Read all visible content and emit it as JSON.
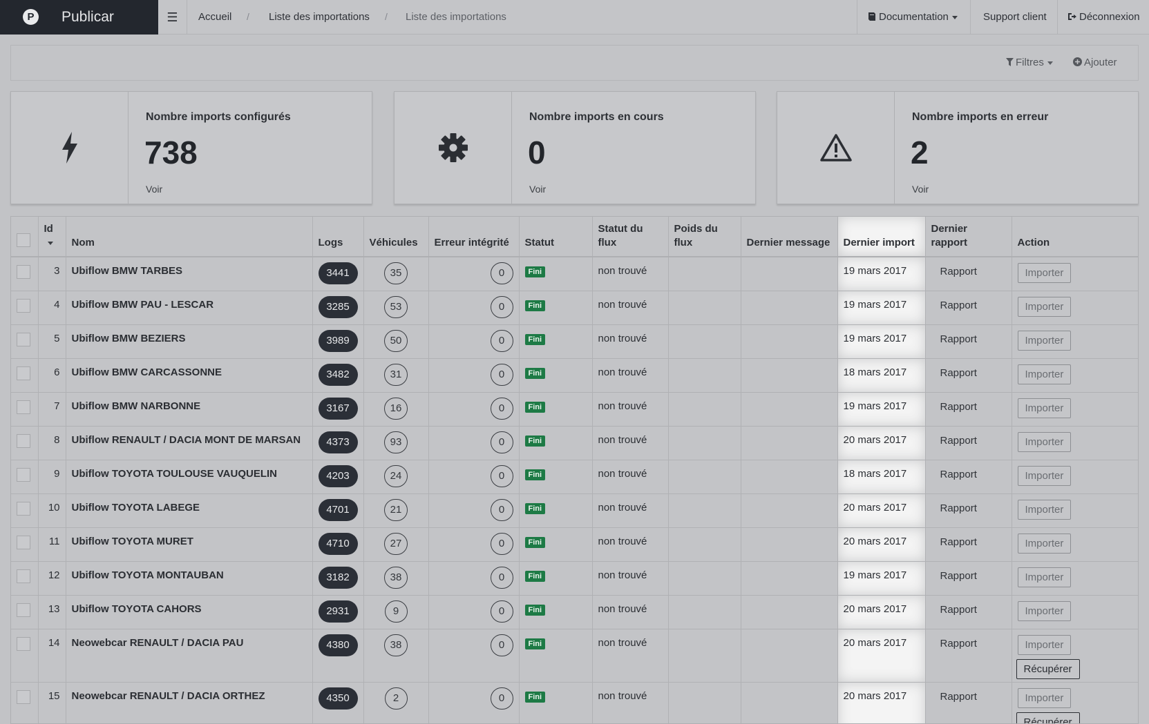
{
  "brand": {
    "name": "Publicar",
    "logo_letter": "P"
  },
  "breadcrumb": [
    "Accueil",
    "Liste des importations",
    "Liste des importations"
  ],
  "nav": {
    "documentation": "Documentation",
    "support": "Support client",
    "logout": "Déconnexion"
  },
  "toolbar": {
    "filters": "Filtres",
    "add": "Ajouter"
  },
  "cards": [
    {
      "title": "Nombre imports configurés",
      "value": "738",
      "link": "Voir",
      "icon": "bolt-icon"
    },
    {
      "title": "Nombre imports en cours",
      "value": "0",
      "link": "Voir",
      "icon": "gear-icon"
    },
    {
      "title": "Nombre imports en erreur",
      "value": "2",
      "link": "Voir",
      "icon": "warning-icon"
    }
  ],
  "table": {
    "headers": {
      "id": "Id",
      "nom": "Nom",
      "logs": "Logs",
      "vehicules": "Véhicules",
      "erreur": "Erreur intégrité",
      "statut": "Statut",
      "statut_flux": "Statut du flux",
      "poids_flux": "Poids du flux",
      "dernier_message": "Dernier message",
      "dernier_import": "Dernier import",
      "dernier_rapport": "Dernier rapport",
      "action": "Action"
    },
    "labels": {
      "fini": "Fini",
      "rapport": "Rapport",
      "importer": "Importer",
      "recuperer": "Récupérer"
    },
    "rows": [
      {
        "id": "3",
        "nom": "Ubiflow BMW TARBES",
        "logs": "3441",
        "vehicules": "35",
        "erreur": "0",
        "statut": "Fini",
        "statut_flux": "non trouvé",
        "dernier_import": "19 mars 2017",
        "recuperer": false
      },
      {
        "id": "4",
        "nom": "Ubiflow BMW PAU - LESCAR",
        "logs": "3285",
        "vehicules": "53",
        "erreur": "0",
        "statut": "Fini",
        "statut_flux": "non trouvé",
        "dernier_import": "19 mars 2017",
        "recuperer": false
      },
      {
        "id": "5",
        "nom": "Ubiflow BMW BEZIERS",
        "logs": "3989",
        "vehicules": "50",
        "erreur": "0",
        "statut": "Fini",
        "statut_flux": "non trouvé",
        "dernier_import": "19 mars 2017",
        "recuperer": false
      },
      {
        "id": "6",
        "nom": "Ubiflow BMW CARCASSONNE",
        "logs": "3482",
        "vehicules": "31",
        "erreur": "0",
        "statut": "Fini",
        "statut_flux": "non trouvé",
        "dernier_import": "18 mars 2017",
        "recuperer": false
      },
      {
        "id": "7",
        "nom": "Ubiflow BMW NARBONNE",
        "logs": "3167",
        "vehicules": "16",
        "erreur": "0",
        "statut": "Fini",
        "statut_flux": "non trouvé",
        "dernier_import": "19 mars 2017",
        "recuperer": false
      },
      {
        "id": "8",
        "nom": "Ubiflow RENAULT / DACIA MONT DE MARSAN",
        "logs": "4373",
        "vehicules": "93",
        "erreur": "0",
        "statut": "Fini",
        "statut_flux": "non trouvé",
        "dernier_import": "20 mars 2017",
        "recuperer": false
      },
      {
        "id": "9",
        "nom": "Ubiflow TOYOTA TOULOUSE VAUQUELIN",
        "logs": "4203",
        "vehicules": "24",
        "erreur": "0",
        "statut": "Fini",
        "statut_flux": "non trouvé",
        "dernier_import": "18 mars 2017",
        "recuperer": false
      },
      {
        "id": "10",
        "nom": "Ubiflow TOYOTA LABEGE",
        "logs": "4701",
        "vehicules": "21",
        "erreur": "0",
        "statut": "Fini",
        "statut_flux": "non trouvé",
        "dernier_import": "20 mars 2017",
        "recuperer": false
      },
      {
        "id": "11",
        "nom": "Ubiflow TOYOTA MURET",
        "logs": "4710",
        "vehicules": "27",
        "erreur": "0",
        "statut": "Fini",
        "statut_flux": "non trouvé",
        "dernier_import": "20 mars 2017",
        "recuperer": false
      },
      {
        "id": "12",
        "nom": "Ubiflow TOYOTA MONTAUBAN",
        "logs": "3182",
        "vehicules": "38",
        "erreur": "0",
        "statut": "Fini",
        "statut_flux": "non trouvé",
        "dernier_import": "19 mars 2017",
        "recuperer": false
      },
      {
        "id": "13",
        "nom": "Ubiflow TOYOTA CAHORS",
        "logs": "2931",
        "vehicules": "9",
        "erreur": "0",
        "statut": "Fini",
        "statut_flux": "non trouvé",
        "dernier_import": "20 mars 2017",
        "recuperer": false
      },
      {
        "id": "14",
        "nom": "Neowebcar RENAULT / DACIA PAU",
        "logs": "4380",
        "vehicules": "38",
        "erreur": "0",
        "statut": "Fini",
        "statut_flux": "non trouvé",
        "dernier_import": "20 mars 2017",
        "recuperer": true
      },
      {
        "id": "15",
        "nom": "Neowebcar RENAULT / DACIA ORTHEZ",
        "logs": "4350",
        "vehicules": "2",
        "erreur": "0",
        "statut": "Fini",
        "statut_flux": "non trouvé",
        "dernier_import": "20 mars 2017",
        "recuperer": true
      }
    ]
  }
}
